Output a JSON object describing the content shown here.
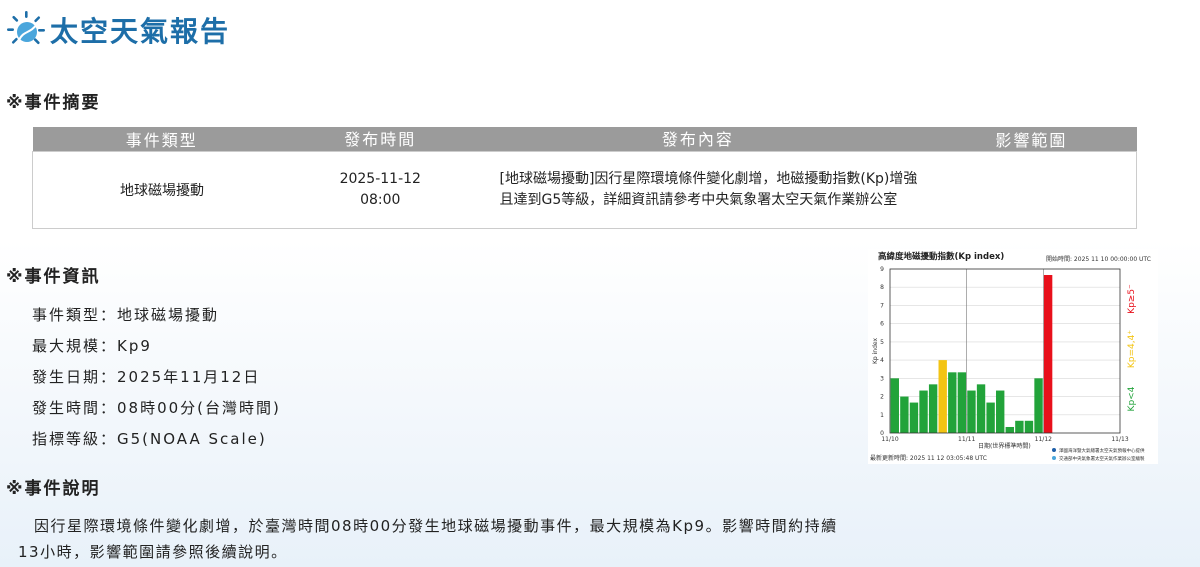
{
  "header": {
    "site_title": "太空天氣報告"
  },
  "sections": {
    "summary_title": "※事件摘要",
    "info_title": "※事件資訊",
    "desc_title": "※事件說明"
  },
  "summary_table": {
    "headers": [
      "事件類型",
      "發布時間",
      "發布內容",
      "影響範圍"
    ],
    "row": {
      "type": "地球磁場擾動",
      "date": "2025-11-12",
      "time": "08:00",
      "content": "[地球磁場擾動]因行星際環境條件變化劇增，地磁擾動指數(Kp)增強且達到G5等級，詳細資訊請參考中央氣象署太空天氣作業辦公室",
      "scope": ""
    }
  },
  "info": {
    "type": "事件類型：地球磁場擾動",
    "max_scale": "最大規模：Kp9",
    "date": "發生日期：2025年11月12日",
    "time": "發生時間：08時00分(台灣時間)",
    "level": "指標等級：G5(NOAA Scale)"
  },
  "description": "因行星際環境條件變化劇增，於臺灣時間08時00分發生地球磁場擾動事件，最大規模為Kp9。影響時間約持續13小時，影響範圍請參照後續說明。",
  "chart_data": {
    "type": "bar",
    "title": "高緯度地磁擾動指數(Kp index)",
    "start_time": "開始時間: 2025 11 10 00:00:00 UTC",
    "updated": "最新更新時間: 2025 11 12 03:05:48 UTC",
    "xlabel": "日期(世界標準時間)",
    "ylabel": "Kp index",
    "ylim": [
      0,
      9
    ],
    "yticks": [
      0,
      1,
      2,
      3,
      4,
      5,
      6,
      7,
      8,
      9
    ],
    "xtick_labels": [
      "11/10",
      "11/11",
      "11/12",
      "11/13"
    ],
    "values": [
      3.0,
      2.0,
      1.67,
      2.33,
      2.67,
      4.0,
      3.33,
      3.33,
      2.33,
      2.67,
      1.67,
      2.33,
      0.33,
      0.67,
      0.67,
      3.0,
      8.67
    ],
    "colors": [
      "green",
      "green",
      "green",
      "green",
      "green",
      "yellow",
      "green",
      "green",
      "green",
      "green",
      "green",
      "green",
      "green",
      "green",
      "green",
      "green",
      "red"
    ],
    "legend": [
      "Kp<4",
      "Kp=4,4⁺",
      "Kp≥5⁻"
    ],
    "palette": {
      "green": "#22a33a",
      "yellow": "#f3c413",
      "red": "#e8101b"
    },
    "credits": [
      "澤國海洋暨大氣總署太空天氣預報中心提供",
      "交通部中央氣象署太空天氣作業辦公室繪製"
    ]
  },
  "colors": {
    "brand": "#1d6ea8",
    "table_header": "#9b9b9b"
  }
}
